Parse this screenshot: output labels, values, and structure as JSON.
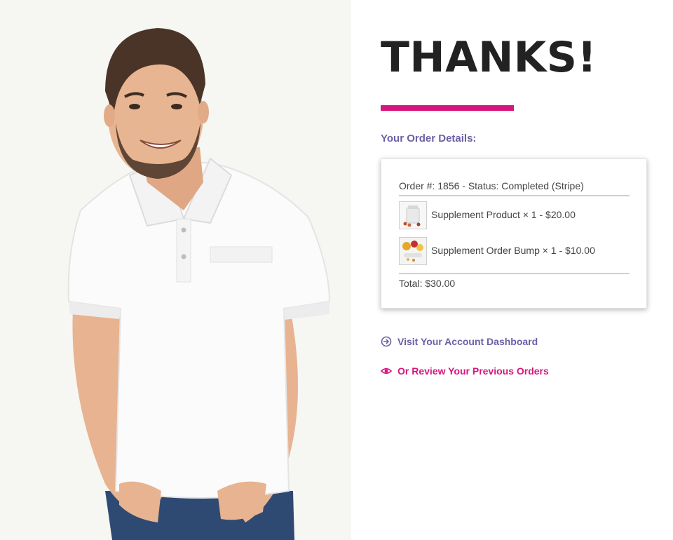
{
  "hero": {
    "image_subject": "smiling man in white polo shirt with hands in jeans pockets"
  },
  "headline": "THANKS!",
  "order_details_heading": "Your Order Details:",
  "order": {
    "summary": "Order #: 1856 - Status: Completed (Stripe)",
    "items": [
      {
        "name": "Supplement Product",
        "qty_text": "× 1",
        "price": "$20.00",
        "line": "Supplement Product × 1 - $20.00",
        "thumb_icon": "supplement-bottle-thumbnail"
      },
      {
        "name": "Supplement Order Bump",
        "qty_text": "× 1",
        "price": "$10.00",
        "line": "Supplement Order Bump × 1 - $10.00",
        "thumb_icon": "fruit-and-pills-thumbnail"
      }
    ],
    "total": "Total: $30.00"
  },
  "links": {
    "dashboard": {
      "label": "Visit Your Account Dashboard",
      "icon": "arrow-circle-right-icon"
    },
    "orders": {
      "label": "Or Review Your Previous Orders",
      "icon": "eye-icon"
    }
  },
  "colors": {
    "accent_pink": "#d6157e",
    "accent_purple": "#6b5fa5",
    "headline": "#222222",
    "body_text": "#444444"
  }
}
